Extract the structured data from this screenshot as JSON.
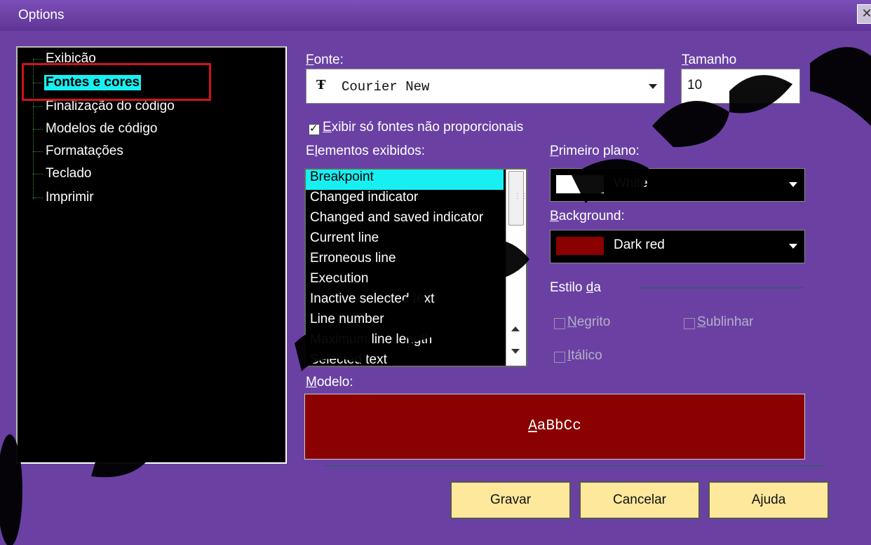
{
  "window": {
    "title": "Options",
    "close_glyph": "✕"
  },
  "tree": {
    "items": [
      {
        "label": "Exibição",
        "selected": false
      },
      {
        "label": "Fontes e cores",
        "selected": true
      },
      {
        "label": "Finalização do código",
        "selected": false
      },
      {
        "label": "Modelos de código",
        "selected": false
      },
      {
        "label": "Formatações",
        "selected": false
      },
      {
        "label": "Teclado",
        "selected": false
      },
      {
        "label": "Imprimir",
        "selected": false
      }
    ]
  },
  "font": {
    "label_u": "F",
    "label_rest": "onte:",
    "value": "Courier New",
    "glyph": "Ŧ"
  },
  "size": {
    "label_u": "T",
    "label_rest": "amanho",
    "value": "10"
  },
  "mono_only": {
    "label_u": "E",
    "label_rest": "xibir só fontes não proporcionais",
    "checked": true
  },
  "elements": {
    "label_pre": "E",
    "label_u": "l",
    "label_rest": "ementos exibidos:",
    "items": [
      "Breakpoint",
      "Changed indicator",
      "Changed and saved indicator",
      "Current line",
      "Erroneous line",
      "Execution",
      "Inactive selected text",
      "Line number",
      "Maximum line length",
      "Selected text"
    ],
    "selected_index": 0
  },
  "foreground": {
    "label_u": "P",
    "label_rest": "rimeiro plano:",
    "value": "White",
    "swatch_color": "#ffffff"
  },
  "background": {
    "label_u": "B",
    "label_rest": "ackground:",
    "value": "Dark red",
    "swatch_color": "#8b0000"
  },
  "style_group": {
    "label_pre": "Estilo ",
    "label_u": "d",
    "label_rest": "a",
    "bold": {
      "label_u": "N",
      "label_rest": "egrito",
      "checked": false
    },
    "underline": {
      "label_u": "S",
      "label_rest": "ublinhar",
      "checked": false
    },
    "italic": {
      "label_u": "I",
      "label_rest": "tálico",
      "checked": false
    }
  },
  "preview": {
    "label_u": "M",
    "label_rest": "odelo:",
    "sample_u": "A",
    "sample_rest": "aBbCc",
    "bg_color": "#8b0000"
  },
  "buttons": {
    "save": "Gravar",
    "cancel": "Cancelar",
    "help": "Ajuda"
  },
  "colors": {
    "window_bg": "#6a41a3",
    "selection": "#17f0f2",
    "button_face": "#fde89b",
    "highlight_box": "#d0121b"
  }
}
